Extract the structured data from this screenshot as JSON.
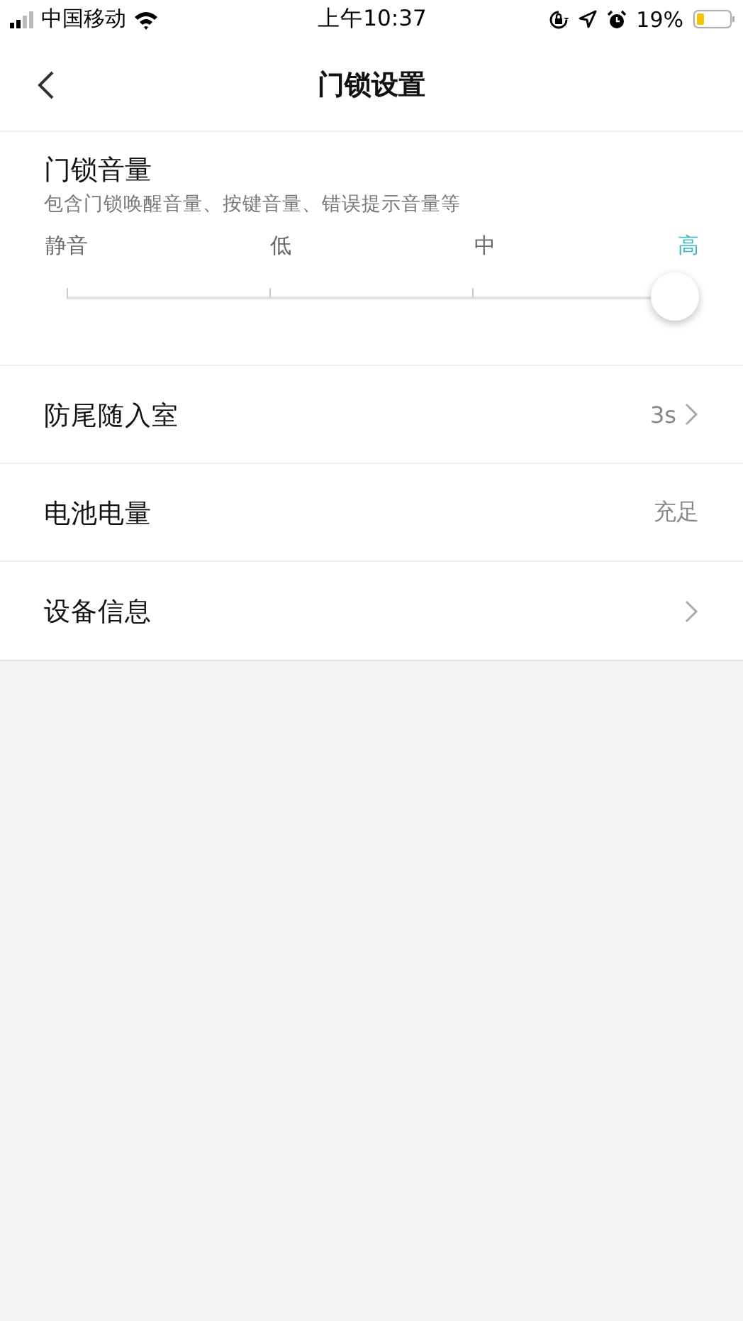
{
  "status_bar": {
    "carrier": "中国移动",
    "time": "上午10:37",
    "battery_percent": "19%"
  },
  "nav": {
    "title": "门锁设置"
  },
  "volume": {
    "title": "门锁音量",
    "description": "包含门锁唤醒音量、按键音量、错误提示音量等",
    "level": 1,
    "stops": [
      {
        "label": "静音",
        "selected": false
      },
      {
        "label": "低",
        "selected": false
      },
      {
        "label": "中",
        "selected": false
      },
      {
        "label": "高",
        "selected": true
      }
    ]
  },
  "rows": [
    {
      "label": "防尾随入室",
      "value": "3s",
      "chevron": true
    },
    {
      "label": "电池电量",
      "value": "充足",
      "chevron": false
    },
    {
      "label": "设备信息",
      "chevron": true
    }
  ]
}
